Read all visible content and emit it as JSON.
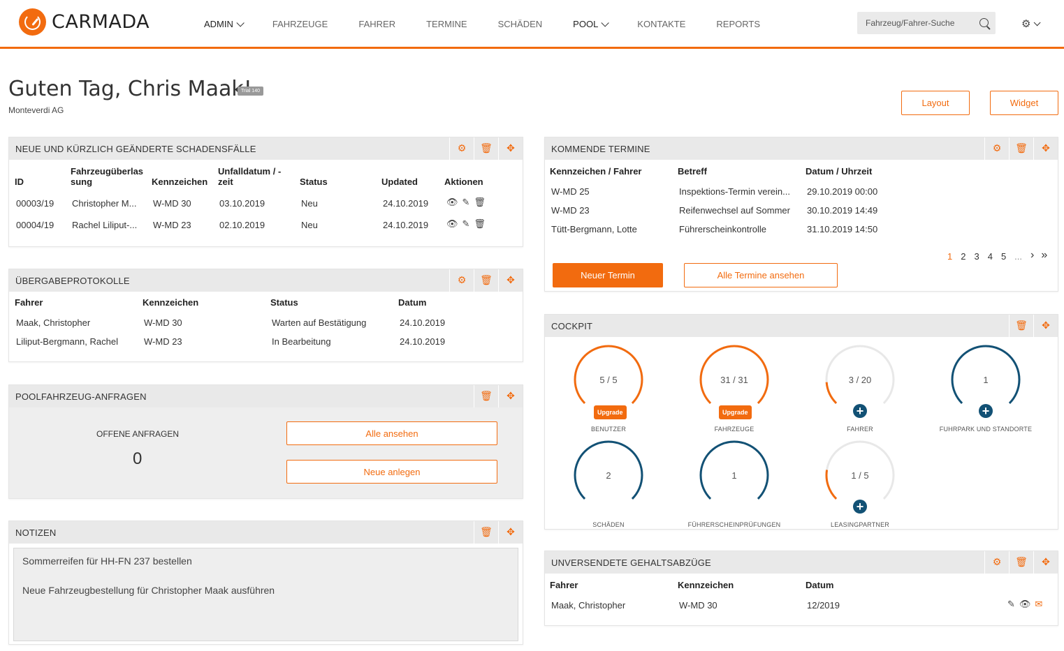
{
  "app": {
    "logo_text": "CARMADA"
  },
  "nav": {
    "items": [
      {
        "label": "ADMIN",
        "dropdown": true
      },
      {
        "label": "FAHRZEUGE"
      },
      {
        "label": "FAHRER"
      },
      {
        "label": "TERMINE"
      },
      {
        "label": "SCHÄDEN"
      },
      {
        "label": "POOL",
        "dropdown": true
      },
      {
        "label": "KONTAKTE"
      },
      {
        "label": "REPORTS"
      }
    ],
    "search_placeholder": "Fahrzeug/Fahrer-Suche"
  },
  "header": {
    "greeting": "Guten Tag, Chris Maak!",
    "trial_badge": "Trial 140",
    "company": "Monteverdi AG",
    "layout_button": "Layout",
    "widget_button": "Widget"
  },
  "colors": {
    "accent": "#f26b0f",
    "dark_blue": "#125175"
  },
  "damages": {
    "title": "NEUE UND KÜRZLICH GEÄNDERTE SCHADENSFÄLLE",
    "headers": [
      "ID",
      "Fahrzeugüberlas sung",
      "Kennzeichen",
      "Unfalldatum / -zeit",
      "Status",
      "Updated",
      "Aktionen"
    ],
    "rows": [
      [
        "00003/19",
        "Christopher M...",
        "W-MD 30",
        "03.10.2019",
        "Neu",
        "24.10.2019"
      ],
      [
        "00004/19",
        "Rachel Liliput-...",
        "W-MD 23",
        "02.10.2019",
        "Neu",
        "24.10.2019"
      ]
    ]
  },
  "handover": {
    "title": "ÜBERGABEPROTOKOLLE",
    "headers": [
      "Fahrer",
      "Kennzeichen",
      "Status",
      "Datum"
    ],
    "rows": [
      [
        "Maak, Christopher",
        "W-MD 30",
        "Warten auf Bestätigung",
        "24.10.2019"
      ],
      [
        "Liliput-Bergmann, Rachel",
        "W-MD 23",
        "In Bearbeitung",
        "24.10.2019"
      ]
    ]
  },
  "pool": {
    "title": "POOLFAHRZEUG-ANFRAGEN",
    "open_label": "OFFENE ANFRAGEN",
    "open_count": "0",
    "view_all": "Alle ansehen",
    "create_new": "Neue anlegen"
  },
  "notes": {
    "title": "NOTIZEN",
    "items": [
      "Sommerreifen für HH-FN 237 bestellen",
      "Neue Fahrzeugbestellung für Christopher Maak ausführen"
    ]
  },
  "appointments": {
    "title": "KOMMENDE TERMINE",
    "headers": [
      "Kennzeichen / Fahrer",
      "Betreff",
      "Datum / Uhrzeit"
    ],
    "rows": [
      [
        "W-MD 25",
        "Inspektions-Termin verein...",
        "29.10.2019 00:00"
      ],
      [
        "W-MD 23",
        "Reifenwechsel auf Sommer",
        "30.10.2019 14:49"
      ],
      [
        "Tütt-Bergmann, Lotte",
        "Führerscheinkontrolle",
        "31.10.2019 14:50"
      ]
    ],
    "pages": [
      "1",
      "2",
      "3",
      "4",
      "5",
      "..."
    ],
    "next": "›",
    "last": "»",
    "new_button": "Neuer Termin",
    "all_button": "Alle Termine ansehen"
  },
  "cockpit": {
    "title": "COCKPIT",
    "gauges": [
      {
        "value": "5 / 5",
        "label": "BENUTZER",
        "fraction": 1.0,
        "upgrade": "Upgrade"
      },
      {
        "value": "31 / 31",
        "label": "FAHRZEUGE",
        "fraction": 1.0,
        "upgrade": "Upgrade"
      },
      {
        "value": "3 / 20",
        "label": "FAHRER",
        "fraction": 0.15
      },
      {
        "value": "1",
        "label": "FUHRPARK UND STANDORTE",
        "fraction": 1.0
      },
      {
        "value": "2",
        "label": "SCHÄDEN",
        "fraction": 1.0
      },
      {
        "value": "1",
        "label": "FÜHRERSCHEINPRÜFUNGEN",
        "fraction": 1.0
      },
      {
        "value": "1 / 5",
        "label": "LEASINGPARTNER",
        "fraction": 0.2
      }
    ]
  },
  "salary": {
    "title": "UNVERSENDETE GEHALTSABZÜGE",
    "headers": [
      "Fahrer",
      "Kennzeichen",
      "Datum"
    ],
    "rows": [
      [
        "Maak, Christopher",
        "W-MD 30",
        "12/2019"
      ]
    ]
  },
  "icons": {
    "settings": "gear-icon",
    "delete": "trash-icon",
    "move": "move-icon",
    "view": "eye-icon",
    "edit": "pencil-icon",
    "mail": "mail-icon"
  }
}
